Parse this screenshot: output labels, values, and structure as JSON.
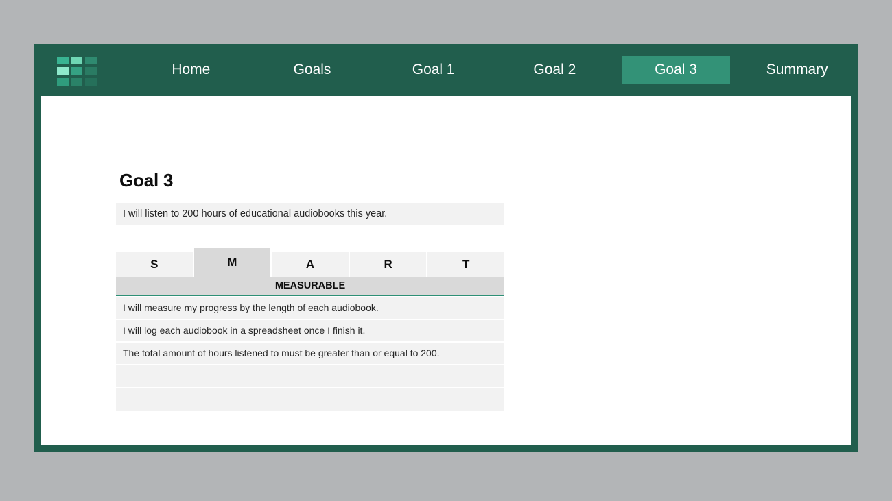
{
  "theme": {
    "frame_green": "#215E4D",
    "accent_green": "#339277",
    "underline_green": "#2e9076",
    "panel_gray": "#f2f2f2",
    "header_gray": "#d9d9d9",
    "page_background": "#b3b5b7"
  },
  "nav": {
    "logo_name": "app-grid-logo",
    "logo_tiles": [
      "#39b392",
      "#6fd6b4",
      "#2f8a70",
      "#8ee8cb",
      "#35a183",
      "#2a7b63",
      "#2f9c7d",
      "#2a8268",
      "#25705a"
    ],
    "items": [
      {
        "label": "Home",
        "active": false
      },
      {
        "label": "Goals",
        "active": false
      },
      {
        "label": "Goal 1",
        "active": false
      },
      {
        "label": "Goal 2",
        "active": false
      },
      {
        "label": "Goal 3",
        "active": true
      },
      {
        "label": "Summary",
        "active": false
      }
    ]
  },
  "main": {
    "title": "Goal 3",
    "goal_statement": "I will listen to 200 hours of educational audiobooks this year.",
    "smart_tabs": [
      {
        "letter": "S",
        "active": false
      },
      {
        "letter": "M",
        "active": true
      },
      {
        "letter": "A",
        "active": false
      },
      {
        "letter": "R",
        "active": false
      },
      {
        "letter": "T",
        "active": false
      }
    ],
    "category_header": "MEASURABLE",
    "detail_rows": [
      "I will measure my progress by the length of each audiobook.",
      "I will log each audiobook in a spreadsheet once I finish it.",
      "The total amount of hours listened to must be greater than or equal to 200.",
      "",
      ""
    ]
  }
}
